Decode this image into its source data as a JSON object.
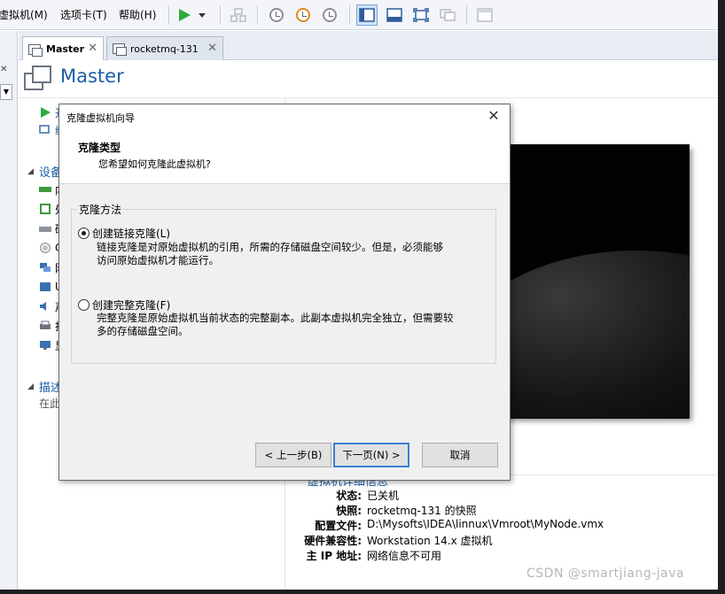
{
  "menubar": {
    "items": [
      "虚拟机(M)",
      "选项卡(T)",
      "帮助(H)"
    ]
  },
  "tabs": [
    {
      "label": "Master"
    },
    {
      "label": "rocketmq-131"
    }
  ],
  "vm": {
    "title": "Master"
  },
  "sidebar": {
    "actions": [
      "开",
      "编"
    ],
    "devices_section": "设备",
    "device_initials": [
      "内",
      "处",
      "硬",
      "C",
      "网",
      "U",
      "声",
      "打",
      "显"
    ],
    "description_section": "描述",
    "description_text": "在此"
  },
  "details": {
    "title": "虚拟机详细信息",
    "rows": [
      {
        "key": "状态:",
        "value": "已关机"
      },
      {
        "key": "快照:",
        "value": "rocketmq-131 的快照"
      },
      {
        "key": "配置文件:",
        "value": "D:\\Mysofts\\IDEA\\linnux\\Vmroot\\MyNode.vmx"
      },
      {
        "key": "硬件兼容性:",
        "value": "Workstation 14.x 虚拟机"
      },
      {
        "key": "主 IP 地址:",
        "value": "网络信息不可用"
      }
    ]
  },
  "dialog": {
    "title": "克隆虚拟机向导",
    "close": "✕",
    "header_title": "克隆类型",
    "header_subtitle": "您希望如何克隆此虚拟机?",
    "group_label": "克隆方法",
    "options": [
      {
        "label": "创建链接克隆(L)",
        "selected": true,
        "desc1": "链接克隆是对原始虚拟机的引用，所需的存储磁盘空间较少。但是，必须能够",
        "desc2": "访问原始虚拟机才能运行。"
      },
      {
        "label": "创建完整克隆(F)",
        "selected": false,
        "desc1": "完整克隆是原始虚拟机当前状态的完整副本。此副本虚拟机完全独立，但需要较",
        "desc2": "多的存储磁盘空间。"
      }
    ],
    "buttons": {
      "back": "< 上一步(B)",
      "next": "下一页(N) >",
      "cancel": "取消"
    }
  },
  "watermark": "CSDN @smartjiang-java",
  "colors": {
    "accent": "#1b5fa8",
    "play": "#2faa3a",
    "snapshot": "#e08a1e"
  }
}
